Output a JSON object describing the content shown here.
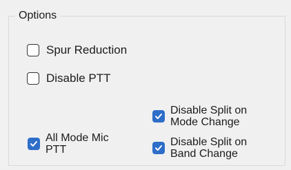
{
  "groupbox": {
    "title": "Options"
  },
  "options": {
    "spur_reduction": {
      "label": "Spur Reduction",
      "checked": false
    },
    "disable_ptt": {
      "label": "Disable PTT",
      "checked": false
    },
    "all_mode_mic_ptt": {
      "label": "All Mode Mic\nPTT",
      "checked": true
    },
    "disable_split_mode_change": {
      "label": "Disable Split on\nMode Change",
      "checked": true
    },
    "disable_split_band_change": {
      "label": "Disable Split on\nBand Change",
      "checked": true
    }
  },
  "colors": {
    "checked_fill": "#2d6ec9",
    "background": "#f0f0f0",
    "border": "#d9d9d9"
  },
  "icons": {
    "checkmark": "checkmark-icon"
  }
}
